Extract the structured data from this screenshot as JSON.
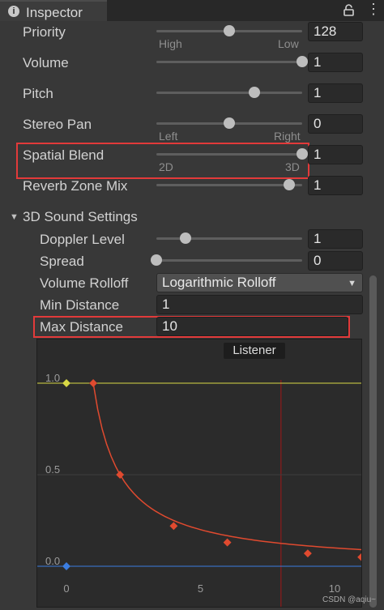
{
  "tab": {
    "title": "Inspector"
  },
  "props": {
    "priority": {
      "label": "Priority",
      "value": "128",
      "left": "High",
      "right": "Low",
      "level": 0.5
    },
    "volume": {
      "label": "Volume",
      "value": "1",
      "level": 1.0
    },
    "pitch": {
      "label": "Pitch",
      "value": "1",
      "level": 0.67
    },
    "stereo_pan": {
      "label": "Stereo Pan",
      "value": "0",
      "left": "Left",
      "right": "Right",
      "level": 0.5
    },
    "spatial_blend": {
      "label": "Spatial Blend",
      "value": "1",
      "left": "2D",
      "right": "3D",
      "level": 1.0
    },
    "reverb": {
      "label": "Reverb Zone Mix",
      "value": "1",
      "level": 0.91
    }
  },
  "sound3d": {
    "header": "3D Sound Settings",
    "doppler": {
      "label": "Doppler Level",
      "value": "1",
      "level": 0.2
    },
    "spread": {
      "label": "Spread",
      "value": "0",
      "level": 0.0
    },
    "rolloff": {
      "label": "Volume Rolloff",
      "value": "Logarithmic Rolloff"
    },
    "min_distance": {
      "label": "Min Distance",
      "value": "1"
    },
    "max_distance": {
      "label": "Max Distance",
      "value": "10"
    }
  },
  "graph": {
    "listener_label": "Listener",
    "y_ticks": [
      "1.0",
      "0.5",
      "0.0"
    ],
    "x_ticks": [
      "0",
      "5",
      "10"
    ],
    "colors": {
      "curve": "#e04a2f",
      "reference": "#d8d845",
      "baseline": "#3b7de0",
      "listener": "#7a1d1d"
    }
  },
  "chart_data": {
    "type": "line",
    "xlim": [
      0,
      11.5
    ],
    "ylim": [
      0,
      1
    ],
    "series": [
      {
        "x": [
          1,
          2,
          4,
          6,
          9,
          11
        ],
        "y": [
          1.0,
          0.5,
          0.22,
          0.13,
          0.07,
          0.05
        ]
      }
    ],
    "listener_x": 8
  },
  "watermark": "CSDN @aqiu~"
}
